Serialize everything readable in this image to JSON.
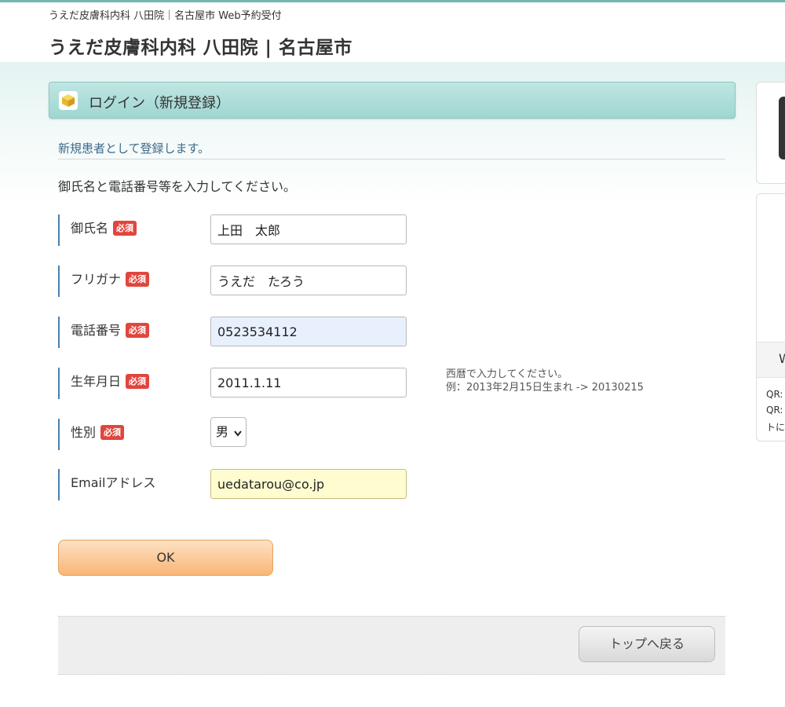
{
  "header": {
    "subtitle": "うえだ皮膚科内科 八田院｜名古屋市 Web予約受付",
    "title": "うえだ皮膚科内科 八田院 | 名古屋市"
  },
  "panel": {
    "title": "ログイン（新規登録）"
  },
  "section": {
    "title": "新規患者として登録します。",
    "intro": "御氏名と電話番号等を入力してください。"
  },
  "required_badge": "必須",
  "form": {
    "name": {
      "label": "御氏名",
      "value": "上田　太郎"
    },
    "kana": {
      "label": "フリガナ",
      "value": "うえだ　たろう"
    },
    "phone": {
      "label": "電話番号",
      "value": "0523534112"
    },
    "birthdate": {
      "label": "生年月日",
      "value": "2011.1.11"
    },
    "gender": {
      "label": "性別",
      "value": "男"
    },
    "email": {
      "label": "Emailアドレス",
      "value": "uedatarou@co.jp"
    }
  },
  "birthdate_hint": {
    "line1": "西暦で入力してください。",
    "line2": "例：2013年2月15日生まれ -> 20130215"
  },
  "buttons": {
    "ok": "OK",
    "back_to_top": "トップへ戻る"
  },
  "sidebar": {
    "band_text": "W",
    "lines": [
      "QR:",
      "QR:",
      "トに"
    ]
  }
}
